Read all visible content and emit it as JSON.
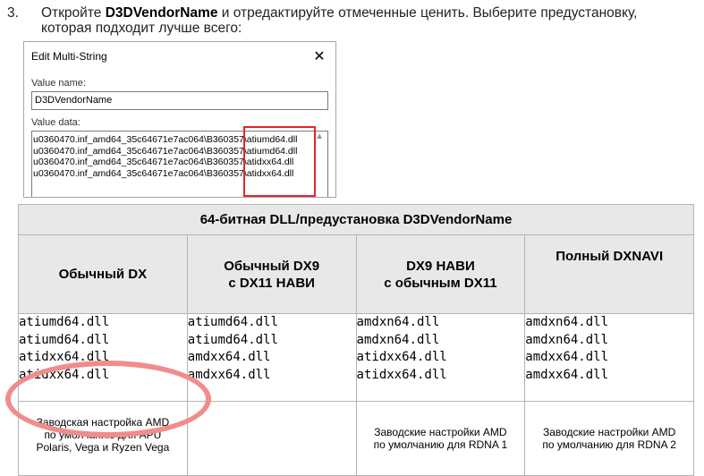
{
  "instruction": {
    "number": "3.",
    "before": "Откройте ",
    "bold": "D3DVendorName",
    "after": " и отредактируйте отмеченные ценить. Выберите предустановку,",
    "line2": "которая подходит лучше всего:"
  },
  "dialog": {
    "title": "Edit Multi-String",
    "close": "✕",
    "value_name_label": "Value name:",
    "value_name": "D3DVendorName",
    "value_data_label": "Value data:",
    "lines": [
      "u0360470.inf_amd64_35c64671e7ac064\\B360357\\atiumd64.dll",
      "u0360470.inf_amd64_35c64671e7ac064\\B360357\\atiumd64.dll",
      "u0360470.inf_amd64_35c64671e7ac064\\B360357\\atidxx64.dll",
      "u0360470.inf_amd64_35c64671e7ac064\\B360357\\atidxx64.dll"
    ],
    "scroll_up": "▲"
  },
  "table": {
    "caption": "64-битная DLL/предустановка D3DVendorName",
    "columns": [
      {
        "h1": "Обычный DX",
        "h2": ""
      },
      {
        "h1": "Обычный DX9",
        "h2": "с DX11 НАВИ"
      },
      {
        "h1": "DX9 НАВИ",
        "h2": "с обычным DX11"
      },
      {
        "h1": "Полный DXNAVI",
        "h2": ""
      }
    ],
    "dlls": [
      [
        "atiumd64.dll",
        "atiumd64.dll",
        "atidxx64.dll",
        "atidxx64.dll"
      ],
      [
        "atiumd64.dll",
        "atiumd64.dll",
        "amdxx64.dll",
        "amdxx64.dll"
      ],
      [
        "amdxn64.dll",
        "amdxn64.dll",
        "atidxx64.dll",
        "atidxx64.dll"
      ],
      [
        "amdxn64.dll",
        "amdxn64.dll",
        "amdxx64.dll",
        "amdxx64.dll"
      ]
    ],
    "notes": [
      [
        "Заводская настройка AMD",
        "по умолчанию для APU",
        "Polaris, Vega и Ryzen Vega"
      ],
      [
        "",
        "",
        ""
      ],
      [
        "Заводские настройки AMD",
        "по умолчанию для RDNA 1",
        ""
      ],
      [
        "Заводские настройки AMD",
        "по умолчанию для RDNA 2",
        ""
      ]
    ]
  },
  "colors": {
    "highlight_box": "#e3262b",
    "oval": "#f08c8c",
    "header_bg": "#e8e8e8"
  }
}
